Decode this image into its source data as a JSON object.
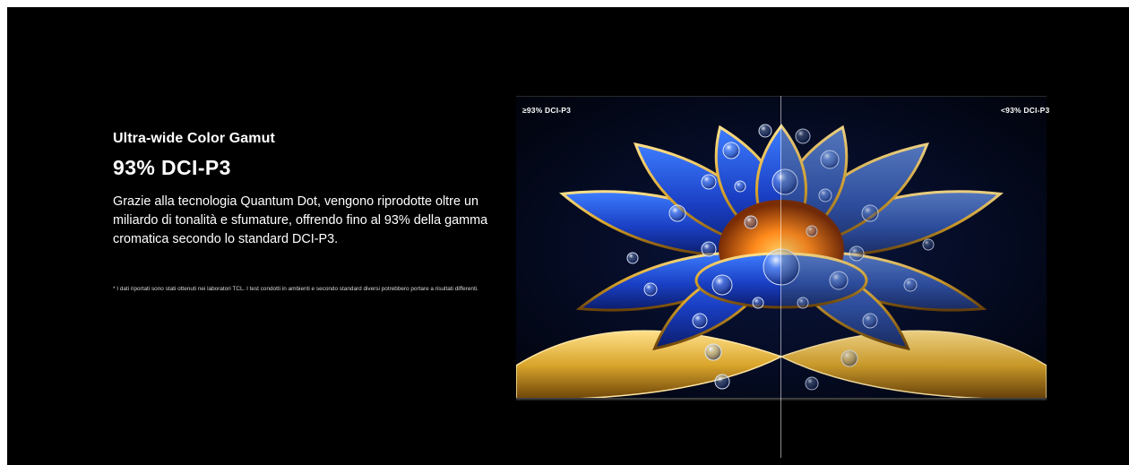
{
  "section": {
    "subtitle": "Ultra-wide Color Gamut",
    "headline": "93% DCI-P3",
    "body": "Grazie alla tecnologia Quantum Dot, vengono riprodotte oltre un miliardo di tonalità e sfumature, offrendo fino al 93% della gamma cromatica secondo lo standard DCI-P3.",
    "footnote": "* I dati riportati sono stati ottenuti nei laboratori TCL.  I test condotti in ambienti e secondo standard diversi potrebbero portare a risultati differenti."
  },
  "comparison": {
    "left_label": "≥93% DCI-P3",
    "right_label": "<93% DCI-P3"
  },
  "colors": {
    "background": "#000000",
    "petal_blue": "#1f4fd8",
    "petal_gold": "#d9a52b",
    "core_orange": "#ff8a1c"
  }
}
